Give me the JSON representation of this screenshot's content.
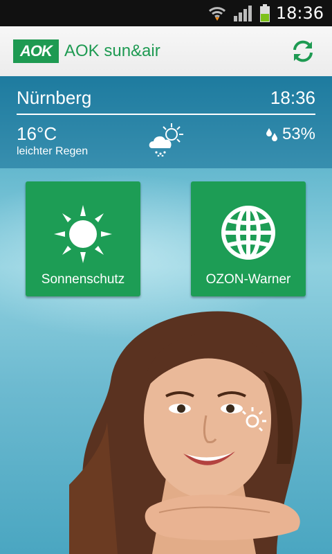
{
  "status_bar": {
    "time": "18:36"
  },
  "app_bar": {
    "logo_text": "AOK",
    "title": "AOK sun&air"
  },
  "weather": {
    "city": "Nürnberg",
    "time": "18:36",
    "temperature": "16°C",
    "description": "leichter Regen",
    "humidity": "53%"
  },
  "tiles": [
    {
      "label": "Sonnenschutz",
      "icon": "sun-icon"
    },
    {
      "label": "OZON-Warner",
      "icon": "globe-icon"
    }
  ],
  "colors": {
    "brand_green": "#1e9a52",
    "tile_green": "#1d9d55"
  }
}
